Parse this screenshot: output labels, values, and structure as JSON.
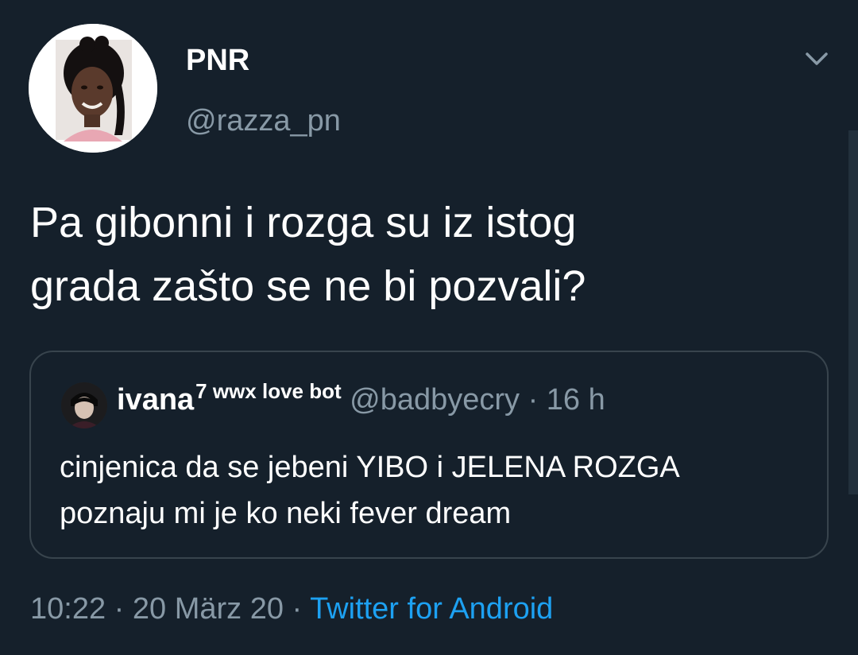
{
  "author": {
    "display_name": "PNR",
    "handle": "@razza_pn",
    "avatar_icon": "profile-photo"
  },
  "tweet": {
    "text_line1": "Pa gibonni i rozga su iz istog",
    "text_line2": "grada zašto se ne bi pozvali?"
  },
  "quoted_tweet": {
    "name": "ivana",
    "name_superscript": "7 wwx love bot",
    "handle_time": "@badbyecry · 16 h",
    "text_line1": "cinjenica da se jebeni YIBO i JELENA ROZGA",
    "text_line2": "poznaju mi je ko neki fever dream"
  },
  "meta": {
    "time": "10:22",
    "date": "20 März 20",
    "separator": " · ",
    "source": "Twitter for Android"
  },
  "icons": {
    "menu": "chevron-down-icon"
  },
  "colors": {
    "background": "#15202b",
    "secondary_text": "#8899a6",
    "link": "#1da1f2",
    "border": "#38444d"
  }
}
